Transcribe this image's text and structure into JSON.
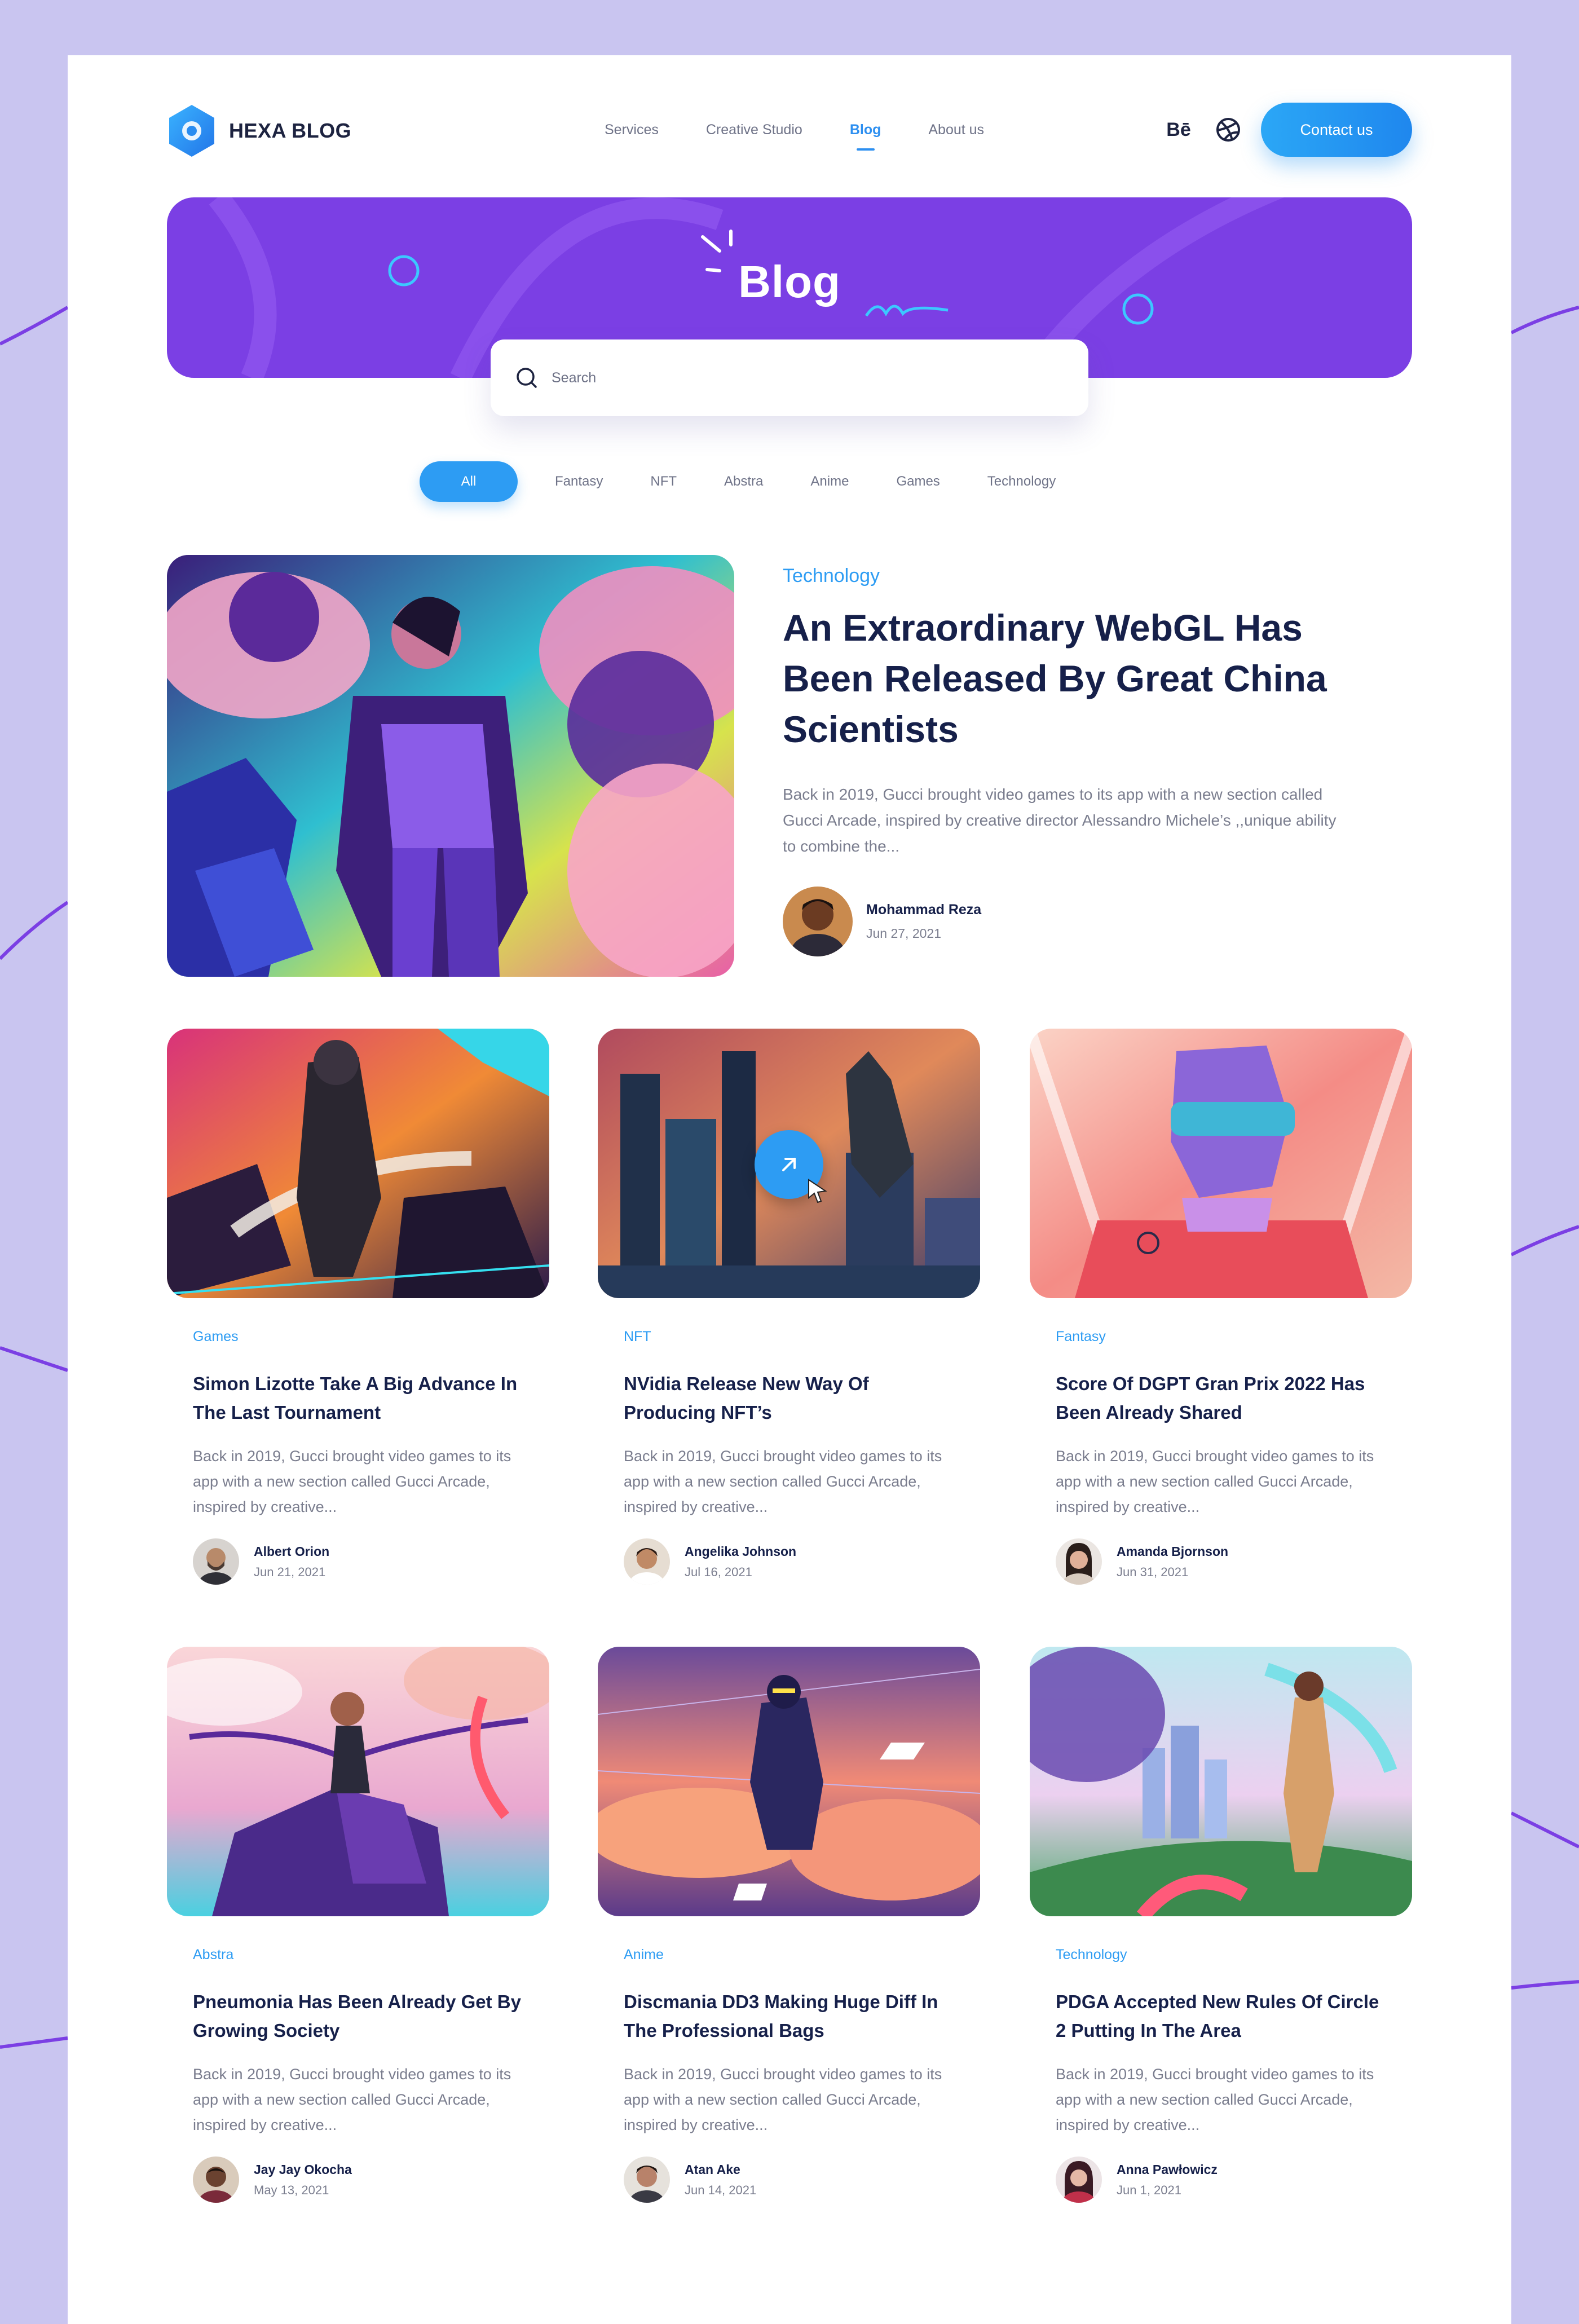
{
  "brand": {
    "name": "HEXA BLOG"
  },
  "nav": [
    {
      "label": "Services",
      "active": false
    },
    {
      "label": "Creative Studio",
      "active": false
    },
    {
      "label": "Blog",
      "active": true
    },
    {
      "label": "About us",
      "active": false
    }
  ],
  "header": {
    "behance_icon": "behance-icon",
    "behance_glyph": "Bē",
    "dribbble_icon": "dribbble-icon",
    "contact_label": "Contact us"
  },
  "hero": {
    "title": "Blog"
  },
  "search": {
    "placeholder": "Search",
    "value": ""
  },
  "filters": [
    {
      "label": "All",
      "active": true
    },
    {
      "label": "Fantasy",
      "active": false
    },
    {
      "label": "NFT",
      "active": false
    },
    {
      "label": "Abstra",
      "active": false
    },
    {
      "label": "Anime",
      "active": false
    },
    {
      "label": "Games",
      "active": false
    },
    {
      "label": "Technology",
      "active": false
    }
  ],
  "featured": {
    "category": "Technology",
    "title": "An Extraordinary WebGL Has Been Released By Great China Scientists",
    "excerpt": "Back in 2019, Gucci brought video games to its app with a new section called Gucci Arcade, inspired by creative director Alessandro Michele’s ,,unique ability to combine the...",
    "author": "Mohammad Reza",
    "date": "Jun 27, 2021"
  },
  "posts": [
    {
      "category": "Games",
      "title": "Simon Lizotte Take A Big Advance In The Last Tournament",
      "excerpt": "Back in 2019, Gucci brought video games to its app with a new section called Gucci Arcade, inspired by creative...",
      "author": "Albert Orion",
      "date": "Jun 21, 2021"
    },
    {
      "category": "NFT",
      "title": "NVidia Release New Way Of Producing NFT’s",
      "excerpt": "Back in 2019, Gucci brought video games to its app with a new section called Gucci Arcade, inspired by creative...",
      "author": "Angelika Johnson",
      "date": "Jul 16, 2021"
    },
    {
      "category": "Fantasy",
      "title": "Score Of DGPT Gran Prix 2022 Has Been Already Shared",
      "excerpt": "Back in 2019, Gucci brought video games to its app with a new section called Gucci Arcade, inspired by creative...",
      "author": "Amanda Bjornson",
      "date": "Jun 31, 2021"
    },
    {
      "category": "Abstra",
      "title": "Pneumonia Has Been Already Get By Growing Society",
      "excerpt": "Back in 2019, Gucci brought video games to its app with a new section called Gucci Arcade, inspired by creative...",
      "author": "Jay Jay Okocha",
      "date": "May 13, 2021"
    },
    {
      "category": "Anime",
      "title": "Discmania DD3 Making Huge Diff In The Professional Bags",
      "excerpt": "Back in 2019, Gucci brought video games to its app with a new section called Gucci Arcade, inspired by creative...",
      "author": "Atan Ake",
      "date": "Jun 14, 2021"
    },
    {
      "category": "Technology",
      "title": "PDGA Accepted New Rules Of Circle 2 Putting In The Area",
      "excerpt": "Back in 2019, Gucci brought video games to its app with a new section called Gucci Arcade, inspired by creative...",
      "author": "Anna Pawłowicz",
      "date": "Jun 1, 2021"
    }
  ],
  "colors": {
    "accent": "#2d9cf3",
    "hero": "#7b3fe4",
    "text_dark": "#16204a",
    "background": "#c9c5f0"
  }
}
